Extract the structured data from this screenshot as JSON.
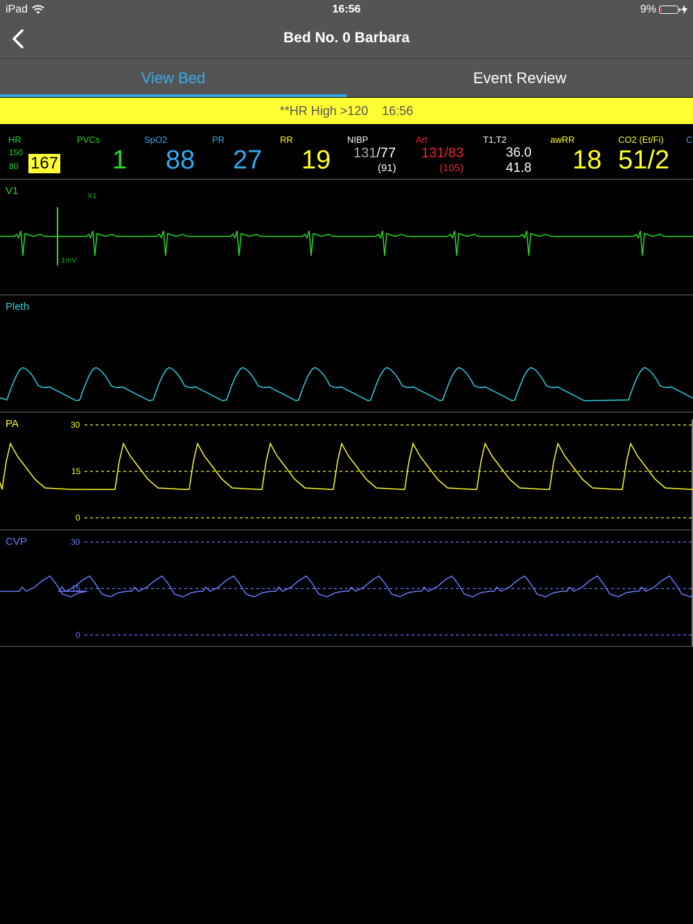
{
  "status_bar": {
    "device": "iPad",
    "time": "16:56",
    "battery": "9%",
    "battery_level": 0.09
  },
  "nav": {
    "title": "Bed No. 0 Barbara"
  },
  "tabs": [
    {
      "label": "View Bed",
      "active": true
    },
    {
      "label": "Event Review",
      "active": false
    }
  ],
  "alarm": {
    "message": "**HR High >120",
    "time": "16:56"
  },
  "params": {
    "hr": {
      "label": "HR",
      "upper": "150",
      "lower": "80",
      "value": "167"
    },
    "pvcs": {
      "label": "PVCs",
      "value": "1"
    },
    "spo2": {
      "label": "SpO2",
      "value": "88"
    },
    "pr": {
      "label": "PR",
      "value": "27"
    },
    "rr": {
      "label": "RR",
      "value": "19"
    },
    "nibp": {
      "label": "NIBP",
      "sys": "131",
      "dia": "/77",
      "mean": "(91)"
    },
    "art": {
      "label": "Art",
      "value": "131/83",
      "mean": "(105)"
    },
    "temp": {
      "label": "T1,T2",
      "t1": "36.0",
      "t2": "41.8"
    },
    "awrr": {
      "label": "awRR",
      "value": "18"
    },
    "co2": {
      "label": "CO2 (Et/Fi)",
      "value": "51/2"
    },
    "cut": {
      "label": "C"
    }
  },
  "waves": {
    "v1": {
      "label": "V1",
      "gain": "X1",
      "cal": "1mV"
    },
    "pleth": {
      "label": "Pleth"
    },
    "pa": {
      "label": "PA",
      "scale": [
        "30",
        "15",
        "0"
      ]
    },
    "cvp": {
      "label": "CVP",
      "scale": [
        "30",
        "15",
        "0"
      ]
    }
  },
  "colors": {
    "green": "#22dd22",
    "cyan": "#2ad4e0",
    "blue": "#33aaee",
    "yellow": "#ffff22",
    "red": "#ee2233",
    "cvp": "#6a7cff",
    "tab_active": "#35aee8",
    "alarm_bg": "#ffff33"
  }
}
